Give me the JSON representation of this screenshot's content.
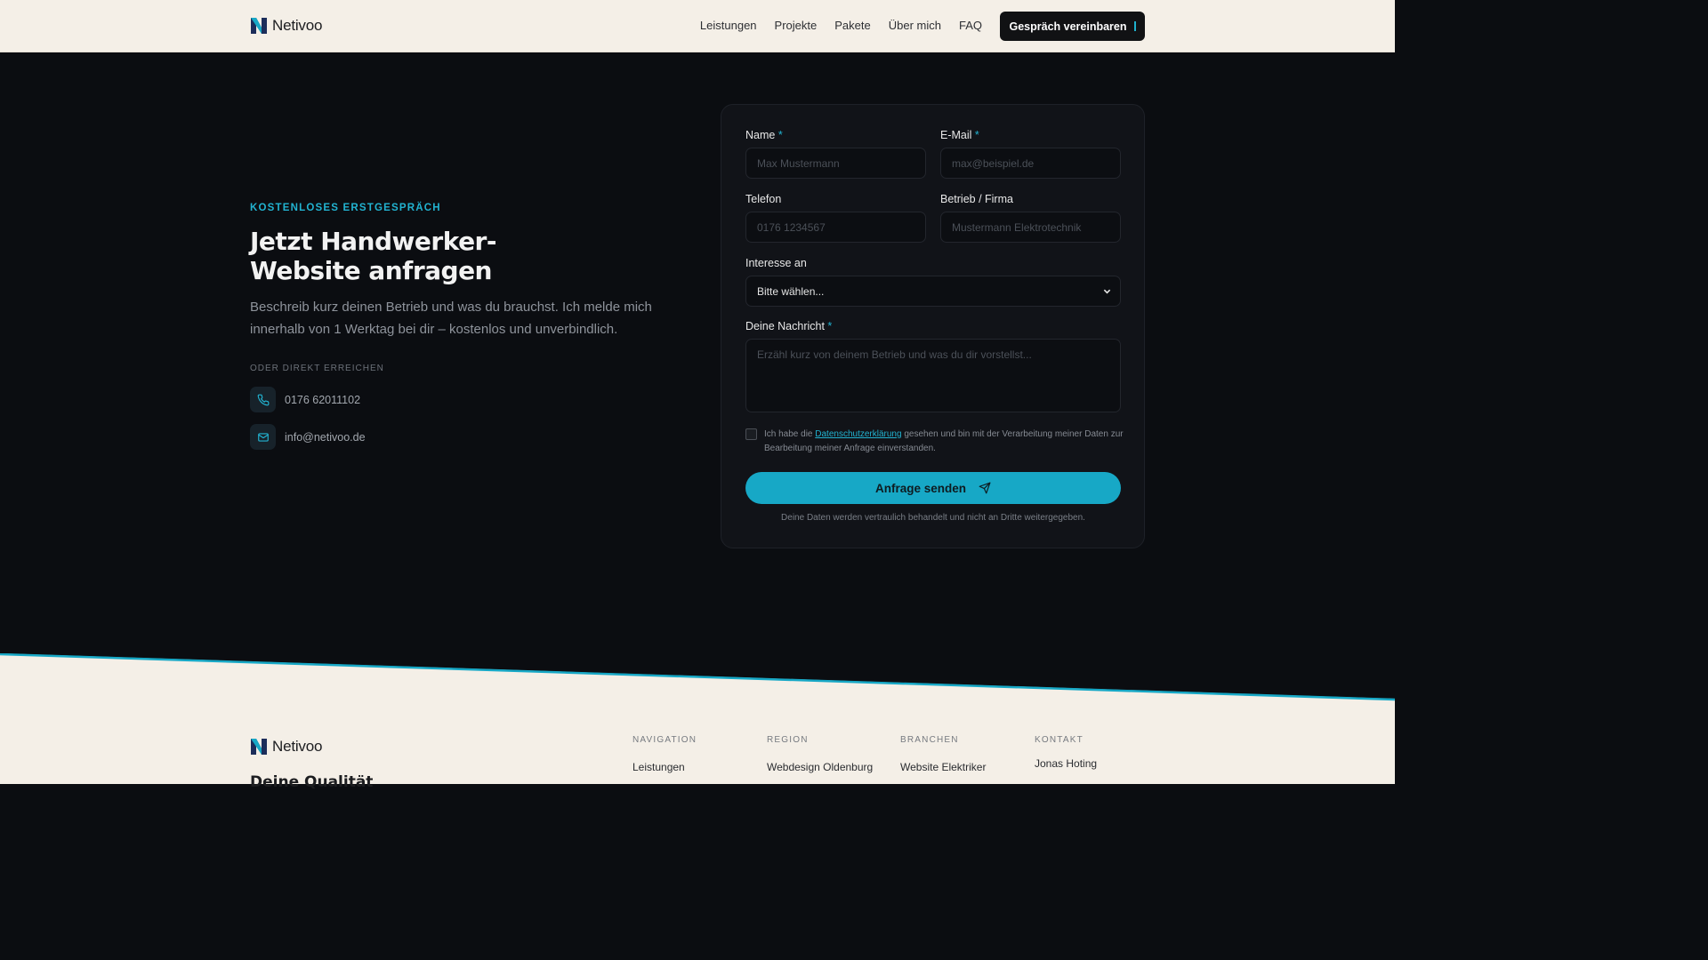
{
  "header": {
    "brand": "Netivoo",
    "nav": [
      "Leistungen",
      "Projekte",
      "Pakete",
      "Über mich",
      "FAQ"
    ],
    "cta": "Gespräch vereinbaren"
  },
  "contact": {
    "eyebrow": "KOSTENLOSES ERSTGESPRÄCH",
    "headline": "Jetzt Handwerker-Website anfragen",
    "lead": "Beschreib kurz deinen Betrieb und was du brauchst. Ich melde mich innerhalb von 1 Werktag bei dir – kostenlos und unverbindlich.",
    "direct_label": "ODER DIREKT ERREICHEN",
    "phone": "0176 62011102",
    "email": "info@netivoo.de"
  },
  "form": {
    "name_label": "Name",
    "name_placeholder": "Max Mustermann",
    "email_label": "E-Mail",
    "email_placeholder": "max@beispiel.de",
    "phone_label": "Telefon",
    "phone_placeholder": "0176 1234567",
    "company_label": "Betrieb / Firma",
    "company_placeholder": "Mustermann Elektrotechnik",
    "interest_label": "Interesse an",
    "interest_value": "Bitte wählen...",
    "message_label": "Deine Nachricht",
    "message_placeholder": "Erzähl kurz von deinem Betrieb und was du dir vorstellst...",
    "required_mark": "*",
    "consent_pre": "Ich habe die ",
    "consent_link": "Datenschutzerklärung",
    "consent_post": " gesehen und bin mit der Verarbeitung meiner Daten zur Bearbeitung meiner Anfrage einverstanden.",
    "submit": "Anfrage senden",
    "privacy_note": "Deine Daten werden vertraulich behandelt und nicht an Dritte weitergegeben."
  },
  "footer": {
    "brand": "Netivoo",
    "tagline": "Deine Qualität",
    "columns": [
      {
        "heading": "NAVIGATION",
        "items": [
          "Leistungen"
        ]
      },
      {
        "heading": "REGION",
        "items": [
          "Webdesign Oldenburg"
        ]
      },
      {
        "heading": "BRANCHEN",
        "items": [
          "Website Elektriker"
        ]
      },
      {
        "heading": "KONTAKT",
        "items": [
          "Jonas Hoting"
        ]
      }
    ]
  },
  "colors": {
    "accent": "#17a8c6",
    "dark_bg": "#0b0d11",
    "light_bg": "#f4efe7"
  }
}
